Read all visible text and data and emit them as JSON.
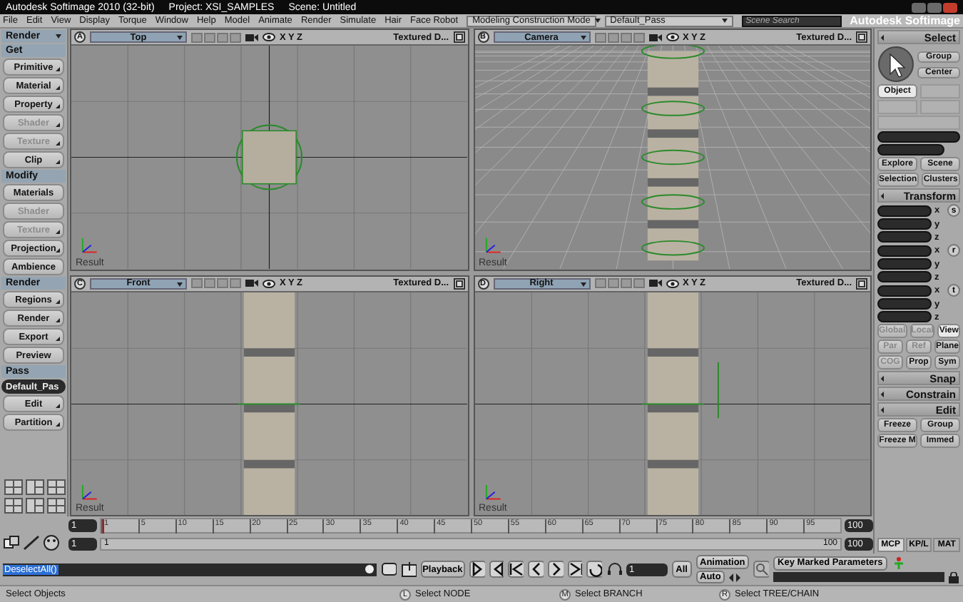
{
  "window": {
    "title": "Autodesk Softimage 2010 (32-bit)",
    "project": "Project: XSI_SAMPLES",
    "scene": "Scene: Untitled"
  },
  "menu": [
    "File",
    "Edit",
    "View",
    "Display",
    "Torque",
    "Window",
    "Help",
    "Model",
    "Animate",
    "Render",
    "Simulate",
    "Hair",
    "Face Robot"
  ],
  "toolbar": {
    "mode": "Modeling Construction Mode",
    "pass": "Default_Pass",
    "search_placeholder": "Scene Search",
    "brand": "Autodesk Softimage"
  },
  "left_panel": {
    "toolbar": "Render",
    "sections": [
      {
        "title": "Get",
        "buttons": [
          {
            "label": "Primitive",
            "disabled": false,
            "has_menu": true
          },
          {
            "label": "Material",
            "disabled": false,
            "has_menu": true
          },
          {
            "label": "Property",
            "disabled": false,
            "has_menu": true
          },
          {
            "label": "Shader",
            "disabled": true,
            "has_menu": true
          },
          {
            "label": "Texture",
            "disabled": true,
            "has_menu": true
          },
          {
            "label": "Clip",
            "disabled": false,
            "has_menu": true
          }
        ]
      },
      {
        "title": "Modify",
        "buttons": [
          {
            "label": "Materials",
            "disabled": false,
            "has_menu": false
          },
          {
            "label": "Shader",
            "disabled": true,
            "has_menu": false
          },
          {
            "label": "Texture",
            "disabled": true,
            "has_menu": true
          },
          {
            "label": "Projection",
            "disabled": false,
            "has_menu": true
          },
          {
            "label": "Ambience",
            "disabled": false,
            "has_menu": false
          }
        ]
      },
      {
        "title": "Render",
        "buttons": [
          {
            "label": "Regions",
            "disabled": false,
            "has_menu": true
          },
          {
            "label": "Render",
            "disabled": false,
            "has_menu": true
          },
          {
            "label": "Export",
            "disabled": false,
            "has_menu": true
          },
          {
            "label": "Preview",
            "disabled": false,
            "has_menu": false
          }
        ]
      },
      {
        "title": "Pass",
        "dropdown": "Default_Pas",
        "buttons": [
          {
            "label": "Edit",
            "disabled": false,
            "has_menu": true
          },
          {
            "label": "Partition",
            "disabled": false,
            "has_menu": true
          }
        ]
      }
    ]
  },
  "viewports": [
    {
      "letter": "A",
      "name": "Top",
      "axes": "X Y Z",
      "mode": "Textured D...",
      "result": "Result",
      "kind": "top"
    },
    {
      "letter": "B",
      "name": "Camera",
      "axes": "X Y Z",
      "mode": "Textured D...",
      "result": "Result",
      "kind": "camera"
    },
    {
      "letter": "C",
      "name": "Front",
      "axes": "X Y Z",
      "mode": "Textured D...",
      "result": "Result",
      "kind": "front"
    },
    {
      "letter": "D",
      "name": "Right",
      "axes": "X Y Z",
      "mode": "Textured D...",
      "result": "Result",
      "kind": "right"
    }
  ],
  "right_panel": {
    "select_title": "Select",
    "select_buttons": [
      "Group",
      "Center"
    ],
    "filters": [
      {
        "label": "Object",
        "selected": true
      }
    ],
    "nav_buttons": [
      "Explore",
      "Scene",
      "Selection",
      "Clusters"
    ],
    "transform_title": "Transform",
    "transform_groups": [
      {
        "letter": "s",
        "axes": [
          "x",
          "y",
          "z"
        ]
      },
      {
        "letter": "r",
        "axes": [
          "x",
          "y",
          "z"
        ]
      },
      {
        "letter": "t",
        "axes": [
          "x",
          "y",
          "z"
        ]
      }
    ],
    "reference": [
      {
        "label": "Global",
        "selected": false,
        "disabled": true
      },
      {
        "label": "Local",
        "selected": false,
        "disabled": true
      },
      {
        "label": "View",
        "selected": true,
        "disabled": false
      },
      {
        "label": "Par",
        "selected": false,
        "disabled": true
      },
      {
        "label": "Ref",
        "selected": false,
        "disabled": true
      },
      {
        "label": "Plane",
        "selected": false,
        "disabled": false
      },
      {
        "label": "COG",
        "selected": false,
        "disabled": true
      },
      {
        "label": "Prop",
        "selected": false,
        "disabled": false
      },
      {
        "label": "Sym",
        "selected": false,
        "disabled": false
      }
    ],
    "sections": [
      "Snap",
      "Constrain",
      "Edit"
    ],
    "edit_buttons": [
      "Freeze",
      "Group",
      "Freeze M",
      "Immed"
    ],
    "tabs": [
      {
        "label": "MCP",
        "selected": true
      },
      {
        "label": "KP/L",
        "selected": false
      },
      {
        "label": "MAT",
        "selected": false
      }
    ]
  },
  "timeline": {
    "start": "1",
    "end": "100",
    "range_start": "1",
    "range": {
      "level": 1,
      "start_label": "1",
      "end_label": "100"
    },
    "range_end": "100",
    "ticks": [
      "1",
      "5",
      "10",
      "15",
      "20",
      "25",
      "30",
      "35",
      "40",
      "45",
      "50",
      "55",
      "60",
      "65",
      "70",
      "75",
      "80",
      "85",
      "90",
      "95"
    ]
  },
  "command": {
    "value": "DeselectAll()"
  },
  "playback": {
    "label": "Playback",
    "frame": "1",
    "all": "All",
    "animation": "Animation",
    "auto": "Auto",
    "key_label": "Key Marked Parameters"
  },
  "status_bar": {
    "message": "Select Objects",
    "hints": [
      {
        "key": "L",
        "label": "Select NODE"
      },
      {
        "key": "M",
        "label": "Select BRANCH"
      },
      {
        "key": "R",
        "label": "Select TREE/CHAIN"
      }
    ]
  }
}
